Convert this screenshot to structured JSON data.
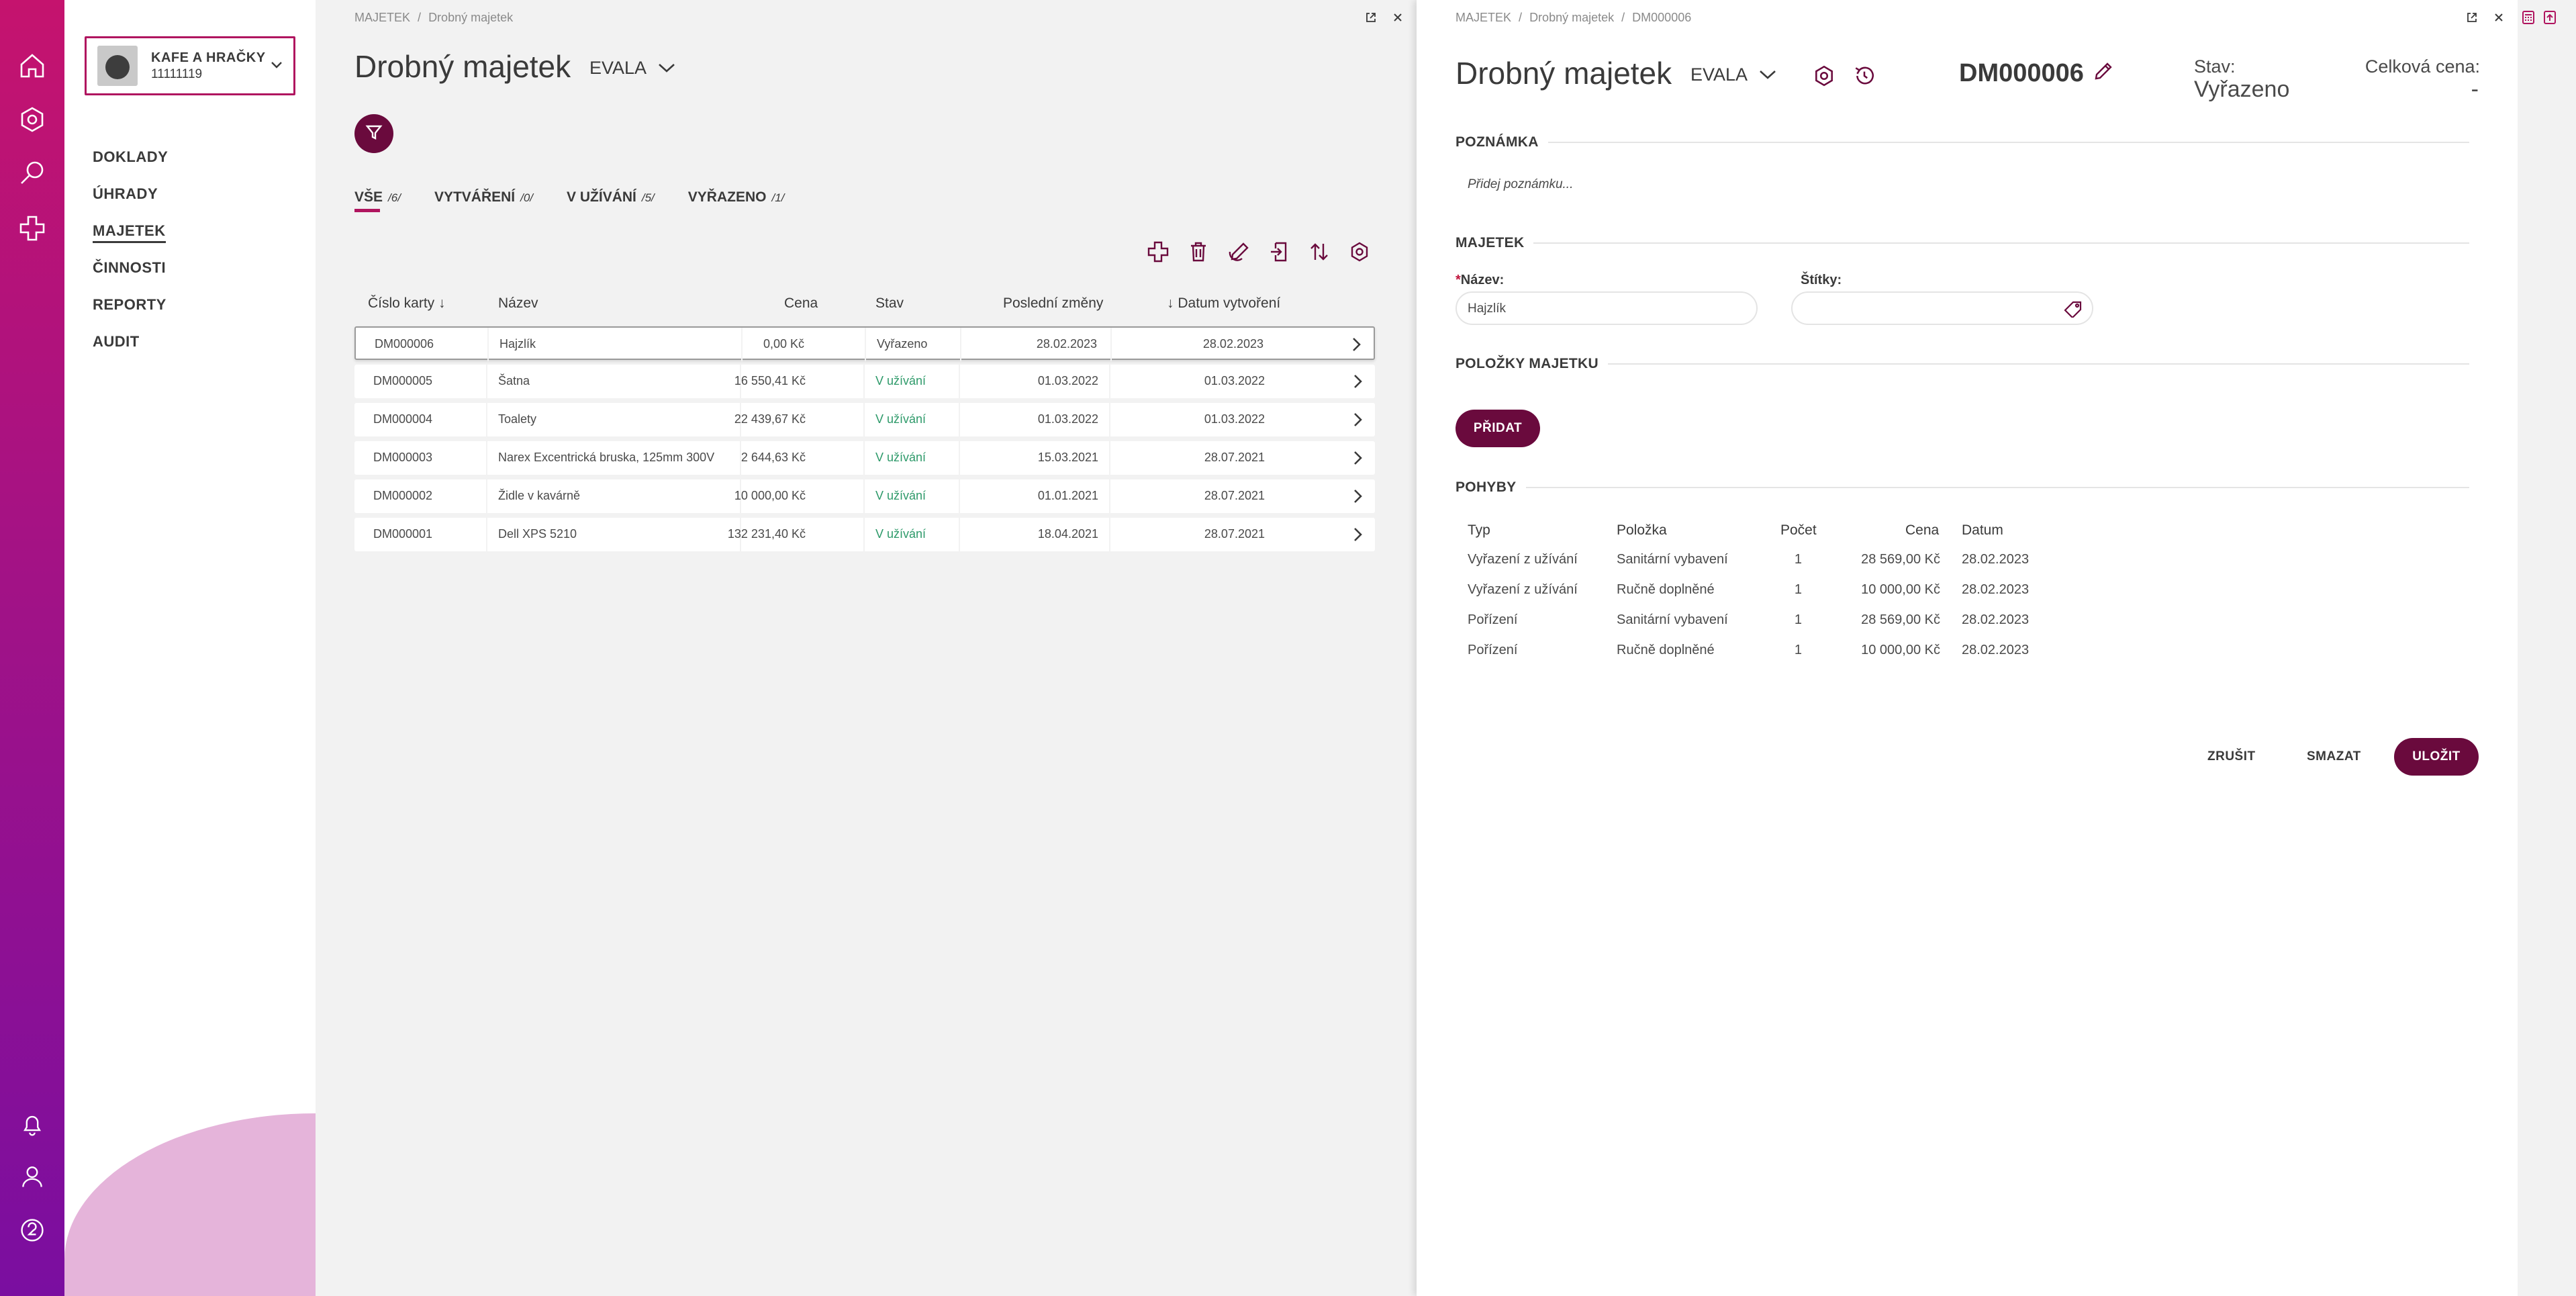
{
  "rail": {
    "icons": [
      "home-icon",
      "gear-icon",
      "search-icon",
      "plus-icon",
      "bell-icon",
      "user-icon",
      "help-icon"
    ]
  },
  "company": {
    "name": "KAFE A HRAČKY",
    "id": "11111119"
  },
  "nav": {
    "items": [
      {
        "label": "DOKLADY"
      },
      {
        "label": "ÚHRADY"
      },
      {
        "label": "MAJETEK"
      },
      {
        "label": "ČINNOSTI"
      },
      {
        "label": "REPORTY"
      },
      {
        "label": "AUDIT"
      }
    ]
  },
  "list": {
    "breadcrumb": {
      "part1": "MAJETEK",
      "sep": "/",
      "part2": "Drobný majetek"
    },
    "title": "Drobný majetek",
    "evala": "EVALA",
    "tabs": [
      {
        "label": "VŠE",
        "count": "/6/"
      },
      {
        "label": "VYTVÁŘENÍ",
        "count": "/0/"
      },
      {
        "label": "V UŽÍVÁNÍ",
        "count": "/5/"
      },
      {
        "label": "VYŘAZENO",
        "count": "/1/"
      }
    ],
    "headers": {
      "cislo": "Číslo karty",
      "nazev": "Název",
      "cena": "Cena",
      "stav": "Stav",
      "zmeny": "Poslední změny",
      "datum": "Datum vytvoření"
    },
    "rows": [
      {
        "cislo": "DM000006",
        "nazev": "Hajzlík",
        "cena": "0,00 Kč",
        "stav": "Vyřazeno",
        "zmeny": "28.02.2023",
        "datum": "28.02.2023"
      },
      {
        "cislo": "DM000005",
        "nazev": "Šatna",
        "cena": "16 550,41 Kč",
        "stav": "V užívání",
        "zmeny": "01.03.2022",
        "datum": "01.03.2022"
      },
      {
        "cislo": "DM000004",
        "nazev": "Toalety",
        "cena": "22 439,67 Kč",
        "stav": "V užívání",
        "zmeny": "01.03.2022",
        "datum": "01.03.2022"
      },
      {
        "cislo": "DM000003",
        "nazev": "Narex Excentrická bruska, 125mm 300V",
        "cena": "2 644,63 Kč",
        "stav": "V užívání",
        "zmeny": "15.03.2021",
        "datum": "28.07.2021"
      },
      {
        "cislo": "DM000002",
        "nazev": "Židle v kavárně",
        "cena": "10 000,00 Kč",
        "stav": "V užívání",
        "zmeny": "01.01.2021",
        "datum": "28.07.2021"
      },
      {
        "cislo": "DM000001",
        "nazev": "Dell XPS 5210",
        "cena": "132 231,40 Kč",
        "stav": "V užívání",
        "zmeny": "18.04.2021",
        "datum": "28.07.2021"
      }
    ]
  },
  "detail": {
    "breadcrumb": {
      "part1": "MAJETEK",
      "sep": "/",
      "part2": "Drobný majetek",
      "part3": "DM000006"
    },
    "title": "Drobný majetek",
    "evala": "EVALA",
    "code": "DM000006",
    "stav_label": "Stav:",
    "stav_value": "Vyřazeno",
    "cena_label": "Celková cena:",
    "cena_value": "-",
    "sections": {
      "poznamka": "POZNÁMKA",
      "majetek": "MAJETEK",
      "polozky": "POLOŽKY MAJETKU",
      "pohyby": "POHYBY"
    },
    "note_placeholder": "Přidej poznámku...",
    "fields": {
      "nazev_label": "Název:",
      "nazev_req": "*",
      "nazev_value": "Hajzlík",
      "stitky_label": "Štítky:"
    },
    "add_button": "PŘIDAT",
    "movements": {
      "headers": {
        "typ": "Typ",
        "polozka": "Položka",
        "pocet": "Počet",
        "cena": "Cena",
        "datum": "Datum"
      },
      "rows": [
        {
          "typ": "Vyřazení z užívání",
          "polozka": "Sanitární vybavení",
          "pocet": "1",
          "cena": "28 569,00 Kč",
          "datum": "28.02.2023"
        },
        {
          "typ": "Vyřazení z užívání",
          "polozka": "Ručně doplněné",
          "pocet": "1",
          "cena": "10 000,00 Kč",
          "datum": "28.02.2023"
        },
        {
          "typ": "Pořízení",
          "polozka": "Sanitární vybavení",
          "pocet": "1",
          "cena": "28 569,00 Kč",
          "datum": "28.02.2023"
        },
        {
          "typ": "Pořízení",
          "polozka": "Ručně doplněné",
          "pocet": "1",
          "cena": "10 000,00 Kč",
          "datum": "28.02.2023"
        }
      ]
    },
    "actions": {
      "cancel": "ZRUŠIT",
      "delete": "SMAZAT",
      "save": "ULOŽIT"
    }
  },
  "colors": {
    "accent": "#6a0a3d",
    "brand": "#b0155f",
    "green": "#2e9a6a"
  }
}
